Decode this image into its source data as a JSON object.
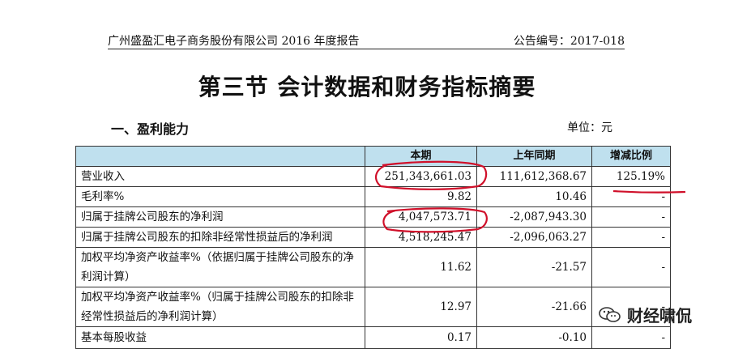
{
  "header": {
    "company": "广州盛盈汇电子商务股份有限公司 2016 年度报告",
    "notice": "公告编号：2017-018"
  },
  "section_title": "第三节 会计数据和财务指标摘要",
  "subsection_title": "一、盈利能力",
  "unit": "单位：元",
  "table": {
    "headers": [
      "",
      "本期",
      "上年同期",
      "增减比例"
    ],
    "rows": [
      {
        "label": "营业收入",
        "current": "251,343,661.03",
        "previous": "111,612,368.67",
        "change": "125.19%"
      },
      {
        "label": "毛利率%",
        "current": "9.82",
        "previous": "10.46",
        "change": "-"
      },
      {
        "label": "归属于挂牌公司股东的净利润",
        "current": "4,047,573.71",
        "previous": "-2,087,943.30",
        "change": "-"
      },
      {
        "label": "归属于挂牌公司股东的扣除非经常性损益后的净利润",
        "current": "4,518,245.47",
        "previous": "-2,096,063.27",
        "change": "-"
      },
      {
        "label": "加权平均净资产收益率%（依据归属于挂牌公司股东的净利润计算）",
        "current": "11.62",
        "previous": "-21.57",
        "change": "-"
      },
      {
        "label": "加权平均净资产收益率%（归属于挂牌公司股东的扣除非经常性损益后的净利润计算）",
        "current": "12.97",
        "previous": "-21.66",
        "change": "-"
      },
      {
        "label": "基本每股收益",
        "current": "0.17",
        "previous": "-0.10",
        "change": "-"
      }
    ]
  },
  "watermark": {
    "text": "财经啸侃",
    "icon": "wechat-icon"
  },
  "colors": {
    "header_fill": "#bfe0ee",
    "annotation": "#d0102a"
  }
}
